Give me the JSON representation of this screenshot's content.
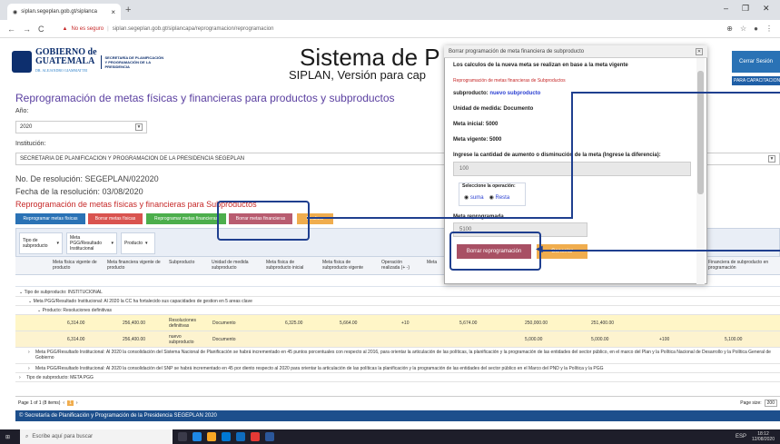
{
  "browser": {
    "tab_title": "siplan.segeplan.gob.gt/siplanca",
    "new_tab": "+",
    "security_label": "No es seguro",
    "url": "siplan.segeplan.gob.gt/siplancapa/reprogramacion/reprogramacion",
    "minimize": "–",
    "restore": "❐",
    "close": "✕"
  },
  "header": {
    "gob_line1": "GOBIERNO de",
    "gob_line2": "GUATEMALA",
    "gob_tag": "DR. ALEJANDRO GIAMMATTEI",
    "secretaria": "SECRETARÍA DE PLANIFICACIÓN Y PROGRAMACIÓN DE LA PRESIDENCIA",
    "title": "Sistema de P",
    "subtitle": "SIPLAN, Versión para cap",
    "logout": "Cerrar Sesión",
    "capacitaciones": "PARA CAPACITACIONES"
  },
  "page": {
    "heading": "Reprogramación de metas físicas y financieras para productos y subproductos",
    "year_label": "Año:",
    "year_value": "2020",
    "institution_label": "Institución:",
    "institution_value": "SECRETARIA DE PLANIFICACION Y PROGRAMACION DE LA PRESIDENCIA SEGEPLAN",
    "resolution": "No. De resolución: SEGEPLAN/022020",
    "resolution_date": "Fecha de la resolución: 03/08/2020",
    "section_title": "Reprogramación de metas físicas y financieras para Subproductos",
    "buttons": [
      "Reprogramar metas físicas",
      "Borrar metas físicas",
      "Reprogramar metas financieras",
      "Borrar metas financieras",
      "Finalizar"
    ]
  },
  "grid": {
    "group_chips": [
      "Tipo de subproducto",
      "Meta PGG/Resultado Institucional",
      "Producto"
    ],
    "columns": [
      "Meta física vigente de producto",
      "Meta financiera vigente de producto",
      "Subproducto",
      "Unidad de medida subproducto",
      "Meta física de subproducto inicial",
      "Meta física de subproducto vigente",
      "Operación realizada (+ -)",
      "Meta",
      "esta",
      "",
      "",
      "Financiera de subproducto en programación"
    ],
    "group_type": "Tipo de subproducto: INSTITUCIONAL",
    "group_meta1": "Meta PGG/Resultado Institucional: Al 2020 la CC ha fortalecido sus capacidades de gestion en 5 areas clave",
    "group_product": "Producto: Resoluciones definitivas",
    "rows": [
      [
        "6,314.00",
        "256,400.00",
        "Resoluciones definitivas",
        "Documento",
        "6,325.00",
        "5,664.00",
        "+10",
        "5,674.00",
        "250,000.00",
        "251,400.00",
        "",
        ""
      ],
      [
        "6,314.00",
        "256,400.00",
        "nuevo subproducto",
        "Documento",
        "",
        "",
        "",
        "",
        "5,000.00",
        "5,000.00",
        "+100",
        "5,100.00"
      ]
    ],
    "group_meta2": "Meta PGG/Resultado Institucional: Al 2020 la consolidación del Sistema Nacional de Planificación se habrá incrementado en 45 puntos porcentuales con respecto al 2016, para orientar la articulación de las políticas, la planificación y la programación de las entidades del sector público, en el marco del Plan y la Política Nacional de Desarrollo y la Política General de Gobierno",
    "group_meta3": "Meta PGG/Resultado Institucional: Al 2020 la consolidación del SNP se habrá incrementado en 45 por diento respecto al 2020 para orientar la articulación de las políticas la planificación y la programación de las entidades del sector público en el Marco del PND y la Política y la PGG",
    "group_type2": "Tipo de subproducto: META PGG",
    "pager_text": "Page 1 of 1 (8 items)",
    "page_number": "1",
    "page_size_label": "Page size:",
    "page_size": "200"
  },
  "footer": "© Secretaría de Planificación y Programación de la Presidencia SEGEPLAN 2020",
  "taskbar": {
    "search": "Escribe aquí para buscar",
    "lang": "ESP",
    "time": "18:12",
    "date": "12/08/2020"
  },
  "modal": {
    "title": "Borrar programación de meta financiera de subproducto",
    "close": "✕",
    "note": "Los calculos de la nueva meta se realizan en base a la meta vigente",
    "red_note": "Reprogramación de metas financieras de Subproductos",
    "subproduct_label": "subproducto:",
    "subproduct_value": "nuevo subproducto",
    "unit": "Unidad de medida: Documento",
    "initial": "Meta inicial: 5000",
    "current": "Meta vigente: 5000",
    "diff_label": "Ingrese la cantidad de aumento o disminución de la meta (Ingrese la diferencia):",
    "diff_value": "100",
    "op_label": "Seleccione la operación:",
    "op_sum": "suma",
    "op_rest": "Resta",
    "reprog_label": "Meta reprogramada",
    "reprog_value": "5100",
    "delete_button": "Borrar reprogramación",
    "cancel_button": "Cancelar"
  }
}
